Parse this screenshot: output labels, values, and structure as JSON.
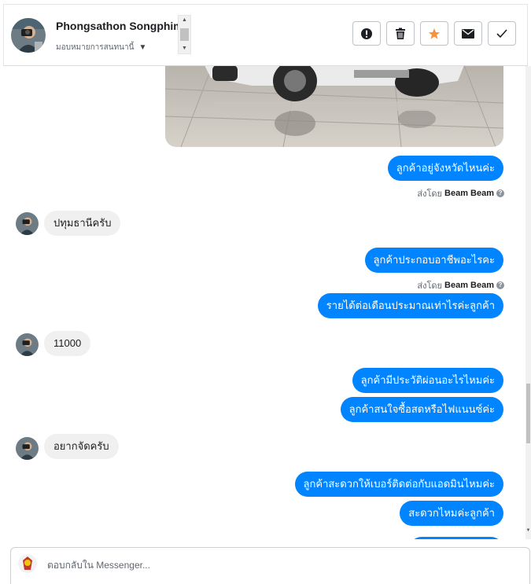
{
  "header": {
    "name": "Phongsathon Songphim",
    "assign_label": "มอบหมายการสนทนานี้"
  },
  "actions": [
    {
      "name": "report-button",
      "icon": "exclamation-icon"
    },
    {
      "name": "delete-button",
      "icon": "trash-icon"
    },
    {
      "name": "star-button",
      "icon": "star-icon"
    },
    {
      "name": "mark-unread-button",
      "icon": "envelope-icon"
    },
    {
      "name": "mark-done-button",
      "icon": "check-icon"
    }
  ],
  "messages": {
    "m1": "ลูกค้าอยู่จังหวัดไหนค่ะ",
    "m2": "ปทุมธานีครับ",
    "m3": "ลูกค้าประกอบอาชีพอะไรคะ",
    "m4": "รายได้ต่อเดือนประมาณเท่าไรค่ะลูกค้า",
    "m5": "11000",
    "m6": "ลูกค้ามีประวัติผ่อนอะไรไหมค่ะ",
    "m7": "ลูกค้าสนใจซื้อสดหรือไฟแนนซ์ค่ะ",
    "m8": "อยากจัดครับ",
    "m9": "ลูกค้าสะดวกให้เบอร์ติดต่อกับแอดมินไหมค่ะ",
    "m10": "สะดวกไหมค่ะลูกค้า"
  },
  "sent_by": {
    "prefix": "ส่งโดย",
    "sender": "Beam Beam"
  },
  "composer": {
    "placeholder": "ตอบกลับใน Messenger..."
  },
  "colors": {
    "outgoing_bubble": "#0084ff",
    "incoming_bubble": "#f1f0f0",
    "star": "#f7923b"
  }
}
